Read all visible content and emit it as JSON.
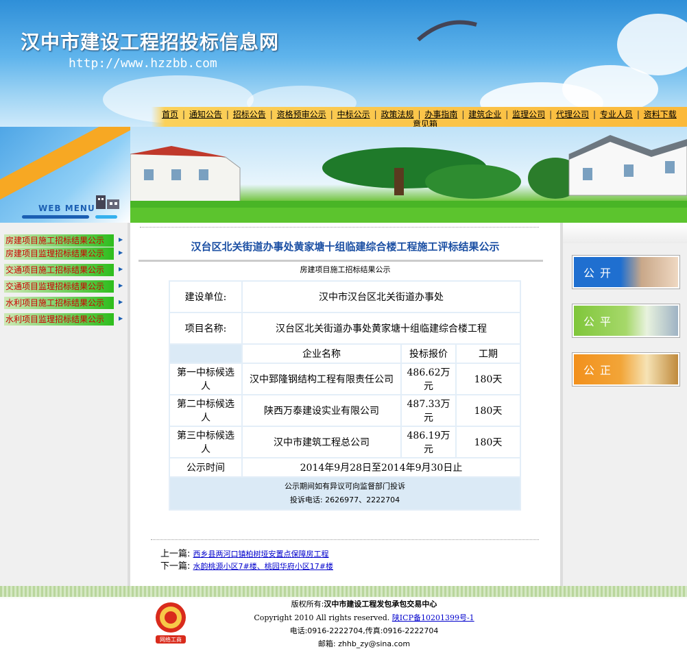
{
  "header": {
    "site_title": "汉中市建设工程招投标信息网",
    "site_url": "http://www.hzzbb.com"
  },
  "nav": {
    "items": [
      "首页",
      "通知公告",
      "招标公告",
      "资格预审公示",
      "中标公示",
      "政策法规",
      "办事指南",
      "建筑企业",
      "监理公司",
      "代理公司",
      "专业人员",
      "资料下载"
    ],
    "second_line": "意见箱"
  },
  "left_menu": {
    "title": "WEB MENU",
    "items": [
      "房建项目施工招标结果公示",
      "房建项目监理招标结果公示",
      "交通项目施工招标结果公示",
      "交通项目监理招标结果公示",
      "水利项目施工招标结果公示",
      "水利项目监理招标结果公示"
    ]
  },
  "article": {
    "title": "汉台区北关街道办事处黄家塘十组临建综合楼工程施工评标结果公示",
    "category": "房建项目施工招标结果公示",
    "table": {
      "owner_label": "建设单位:",
      "owner_value": "汉中市汉台区北关街道办事处",
      "project_label": "项目名称:",
      "project_value": "汉台区北关街道办事处黄家塘十组临建综合楼工程",
      "col_company": "企业名称",
      "col_price": "投标报价",
      "col_period": "工期",
      "rows": [
        {
          "rank": "第一中标候选人",
          "company": "汉中郅隆钢结构工程有限责任公司",
          "price": "486.62万元",
          "period": "180天"
        },
        {
          "rank": "第二中标候选人",
          "company": "陕西万泰建设实业有限公司",
          "price": "487.33万元",
          "period": "180天"
        },
        {
          "rank": "第三中标候选人",
          "company": "汉中市建筑工程总公司",
          "price": "486.19万元",
          "period": "180天"
        }
      ],
      "time_label": "公示时间",
      "time_value": "2014年9月28日至2014年9月30日止",
      "note_line1": "公示期间如有异议可向监督部门投诉",
      "note_line2": "投诉电话: 2626977、2222704"
    },
    "prev_label": "上一篇:",
    "prev_title": "西乡县两河口镇柏树垭安置点保障房工程",
    "next_label": "下一篇:",
    "next_title": "水韵桃源小区7#楼、桃园华府小区17#楼"
  },
  "promos": [
    {
      "label": "公开",
      "color": "#1f6fd0"
    },
    {
      "label": "公平",
      "color": "#7fc63a"
    },
    {
      "label": "公正",
      "color": "#f2901c"
    }
  ],
  "footer": {
    "copyright_prefix": "版权所有:",
    "owner": "汉中市建设工程发包承包交易中心",
    "rights": "Copyright 2010 All rights reserved.",
    "icp": "陕ICP备10201399号-1",
    "phone": "电话:0916-2222704,传真:0916-2222704",
    "email": "邮箱: zhhb_zy@sina.com",
    "badge_text": "网络工商"
  }
}
